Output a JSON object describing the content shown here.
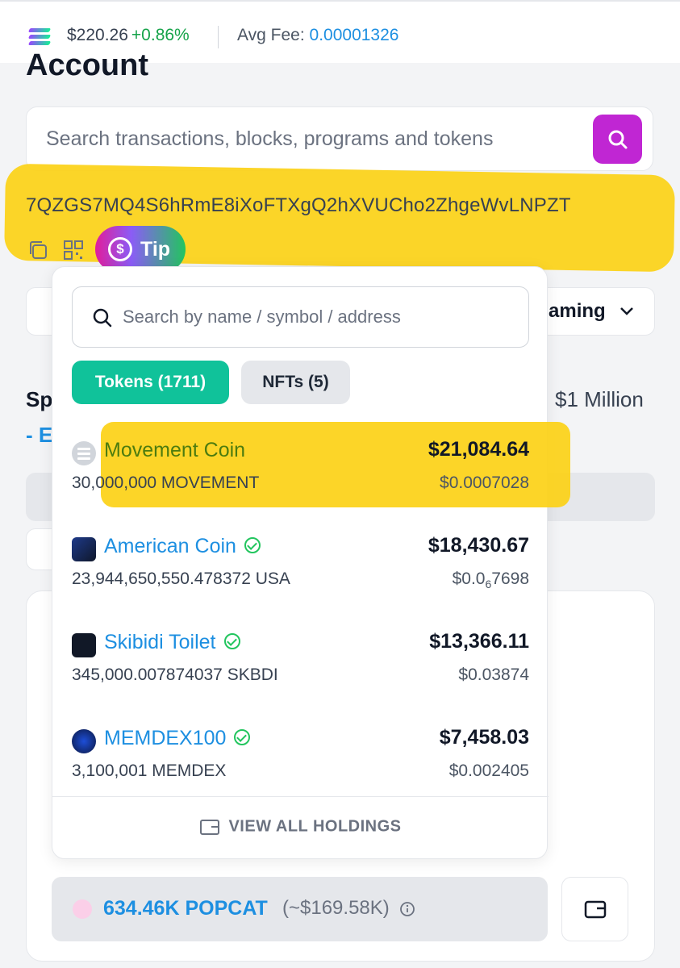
{
  "topbar": {
    "sol_price": "$220.26",
    "sol_change": "+0.86%",
    "fee_label": "Avg Fee:",
    "fee_value": "0.00001326"
  },
  "page": {
    "title": "Account",
    "search_placeholder": "Search transactions, blocks, programs and tokens",
    "address": "7QZGS7MQ4S6hRmE8iXoFTXgQ2hXVUCho2ZhgeWvLNPZT",
    "tip_label": "Tip",
    "streaming_label": "aming",
    "balance_label": "$1 Million",
    "section_partial": "Sp",
    "link_partial": "- E"
  },
  "dropdown": {
    "search_placeholder": "Search by name / symbol / address",
    "tabs": [
      {
        "label": "Tokens (1711)",
        "active": true
      },
      {
        "label": "NFTs (5)",
        "active": false
      }
    ],
    "tokens": [
      {
        "name": "Movement Coin",
        "verified": false,
        "amount": "30,000,000 MOVEMENT",
        "value": "$21,084.64",
        "price": "$0.0007028"
      },
      {
        "name": "American Coin",
        "verified": true,
        "amount": "23,944,650,550.478372 USA",
        "value": "$18,430.67",
        "price_main": "$0.0",
        "price_sub": "6",
        "price_tail": "7698"
      },
      {
        "name": "Skibidi Toilet",
        "verified": true,
        "amount": "345,000.007874037 SKBDI",
        "value": "$13,366.11",
        "price": "$0.03874"
      },
      {
        "name": "MEMDEX100",
        "verified": true,
        "amount": "3,100,001 MEMDEX",
        "value": "$7,458.03",
        "price": "$0.002405"
      }
    ],
    "view_all": "VIEW ALL HOLDINGS"
  },
  "bottom": {
    "holding": "634.46K POPCAT",
    "holding_value": "(~$169.58K)"
  },
  "colors": {
    "accent_blue": "#1d8fe1",
    "positive_green": "#16a34a",
    "tab_active": "#10c29a",
    "search_button": "#c026d3",
    "highlighter": "#fcd116"
  }
}
